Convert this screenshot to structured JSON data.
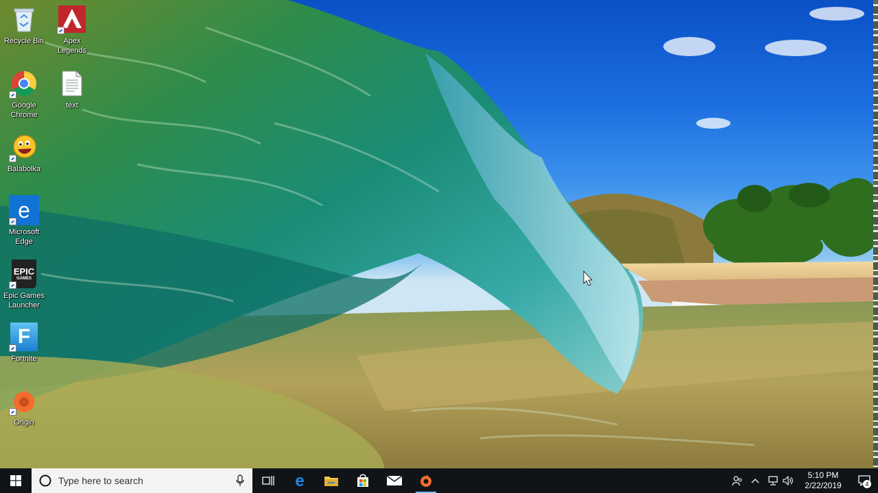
{
  "desktop": {
    "icons": [
      {
        "id": "recycle-bin",
        "label": "Recycle Bin",
        "icon": "recycle-bin-icon"
      },
      {
        "id": "apex",
        "label": "Apex Legends",
        "icon": "apex-legends-icon"
      },
      {
        "id": "chrome",
        "label": "Google Chrome",
        "icon": "chrome-icon"
      },
      {
        "id": "text",
        "label": "text",
        "icon": "text-file-icon"
      },
      {
        "id": "balabolka",
        "label": "Balabolka",
        "icon": "balabolka-icon"
      },
      {
        "id": "edge",
        "label": "Microsoft Edge",
        "icon": "edge-icon"
      },
      {
        "id": "epic",
        "label": "Epic Games Launcher",
        "icon": "epic-games-icon",
        "glyph_text": "EPIC",
        "glyph_sub": "GAMES"
      },
      {
        "id": "fortnite",
        "label": "Fortnite",
        "icon": "fortnite-icon",
        "glyph_text": "F"
      },
      {
        "id": "origin",
        "label": "Origin",
        "icon": "origin-icon"
      }
    ]
  },
  "taskbar": {
    "search_placeholder": "Type here to search",
    "apps": [
      {
        "id": "task-view",
        "icon": "task-view-icon"
      },
      {
        "id": "edge",
        "icon": "edge-icon"
      },
      {
        "id": "file-explorer",
        "icon": "folder-icon"
      },
      {
        "id": "store",
        "icon": "store-icon"
      },
      {
        "id": "mail",
        "icon": "mail-icon"
      },
      {
        "id": "origin",
        "icon": "origin-icon",
        "running": true
      }
    ],
    "tray": {
      "time": "5:10 PM",
      "date": "2/22/2019",
      "notification_count": "4"
    }
  },
  "colors": {
    "taskbar_bg": "#101418",
    "search_bg": "#f3f3f3",
    "accent": "#0078d7"
  }
}
